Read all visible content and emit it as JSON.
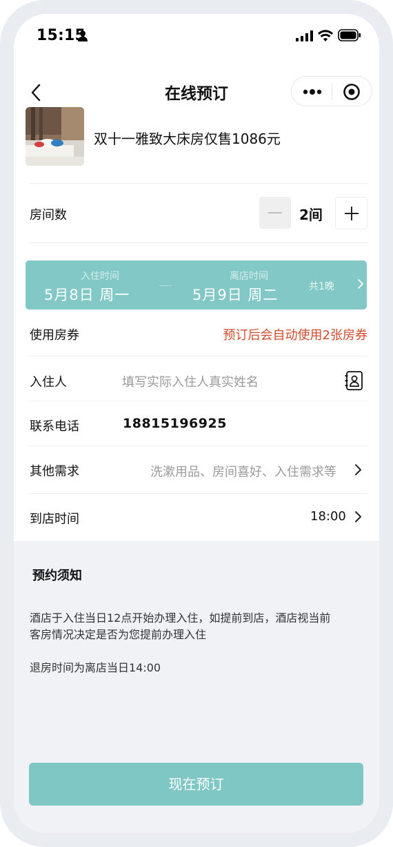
{
  "status_bar": {
    "time": "15:15"
  },
  "nav": {
    "title": "在线预订"
  },
  "product": {
    "name": "双十一雅致大床房仅售1086元"
  },
  "rooms": {
    "label": "房间数",
    "count": "2间"
  },
  "dates": {
    "checkin_label": "入住时间",
    "checkin_value": "5月8日  周一",
    "checkout_label": "离店时间",
    "checkout_value": "5月9日  周二",
    "nights": "共1晚"
  },
  "coupon": {
    "label": "使用房券",
    "hint": "预订后会自动使用2张房券"
  },
  "guest": {
    "label": "入住人",
    "placeholder": "填写实际入住人真实姓名"
  },
  "contact": {
    "label": "联系电话",
    "value": "18815196925"
  },
  "requests": {
    "label": "其他需求",
    "placeholder": "洗漱用品、房间喜好、入住需求等"
  },
  "arrival": {
    "label": "到店时间",
    "value": "18:00"
  },
  "notice": {
    "title": "预约须知",
    "line1": "酒店于入住当日12点开始办理入住，如提前到店，酒店视当前",
    "line2": "客房情况决定是否为您提前办理入住",
    "line3": "退房时间为离店当日14:00"
  },
  "cta": {
    "label": "现在预订"
  },
  "colors": {
    "accent": "#7fc7c5",
    "warning": "#d24a2b"
  }
}
